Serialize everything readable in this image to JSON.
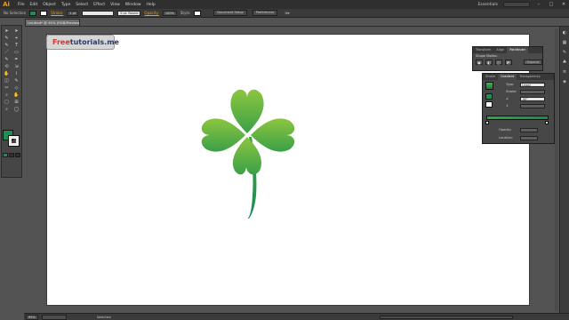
{
  "app": {
    "logo": "Ai"
  },
  "menu": {
    "items": [
      "File",
      "Edit",
      "Object",
      "Type",
      "Select",
      "Effect",
      "View",
      "Window",
      "Help"
    ],
    "workspace": "Essentials"
  },
  "controlbar": {
    "selection_label": "No Selection",
    "fill_color": "#1e8e55",
    "stroke_label": "Stroke:",
    "stroke_weight": "1 pt",
    "profile": "5 pt. Round",
    "opacity_label": "Opacity:",
    "opacity_value": "100%",
    "style_label": "Style:",
    "doc_setup": "Document Setup",
    "preferences": "Preferences"
  },
  "document": {
    "tab_title": "Untitled* @ 95% (RGB/Preview)"
  },
  "tools": {
    "glyphs": [
      "➤",
      "➤",
      "✎",
      "⌖",
      "✎",
      "T",
      "／",
      "▭",
      "✎",
      "✒",
      "⟲",
      "⇲",
      "✋",
      "⌇",
      "◫",
      "✎",
      "✂",
      "◇",
      "⌕",
      "✋",
      "□",
      "⊞",
      "⌕",
      "◯"
    ]
  },
  "watermark": {
    "brand_red": "Free",
    "brand_blue": "tutorials.me"
  },
  "pathfinder": {
    "tabs": [
      "Transform",
      "Align",
      "Pathfinder"
    ],
    "shape_modes_label": "Shape Modes:",
    "pathfinders_label": "Pathfinders:",
    "expand": "Expand"
  },
  "gradient_panel": {
    "tabs": [
      "Stroke",
      "Gradient",
      "Transparency"
    ],
    "type_label": "Type:",
    "type_value": "Linear",
    "stroke_label": "Stroke:",
    "angle_value": "-90°",
    "opacity_label": "Opacity:",
    "location_label": "Location:"
  },
  "status": {
    "zoom": "95%",
    "tool": "Selection"
  },
  "colors": {
    "leaf_light": "#8cc53f",
    "leaf_dark": "#3aa048",
    "stem": "#1e8e55"
  }
}
